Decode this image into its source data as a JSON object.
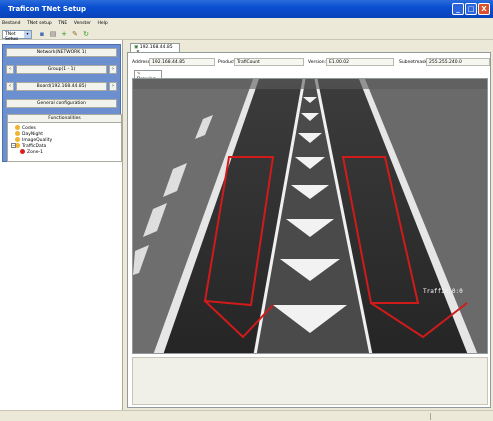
{
  "window": {
    "title": "Traficon TNet Setup",
    "controls": {
      "minimize": "_",
      "maximize": "□",
      "close": "X"
    }
  },
  "menu": [
    "Bestand",
    "TNet setup",
    "TNE",
    "Venster",
    "Help"
  ],
  "toolbar": {
    "selector_value": "TNet Setup",
    "icons": [
      "save-icon",
      "print-icon",
      "add-icon",
      "tools-icon",
      "refresh-icon"
    ]
  },
  "left_panel": {
    "network_label": "Network(NETWORK 1)",
    "group_label": "Group(1 - 1)",
    "board_label": "Board(192.168.44.85)",
    "general_config_label": "General configuration",
    "functionalities": {
      "header": "Functionalities",
      "items": [
        {
          "label": "Codes",
          "icon": "yellow-dot"
        },
        {
          "label": "DayNight",
          "icon": "yellow-dot"
        },
        {
          "label": "ImageQuality",
          "icon": "yellow-dot"
        },
        {
          "label": "TrafficData",
          "icon": "yellow-dot",
          "expanded": true
        },
        {
          "label": "Zone-1",
          "icon": "red-dot"
        }
      ]
    }
  },
  "document": {
    "tab_label": "192.168.44.85",
    "address_label": "Address:",
    "address_value": "192.168.44.85",
    "product_label": "Product:",
    "product_value": "TrafiCount",
    "version_label": "Version:",
    "version_value": "E1.00.02",
    "subnetmask_label": "Subnetmask:",
    "subnetmask_value": "255.255.240.0",
    "drawing_tab_label": "Drawing",
    "overlay_text": "Traffic 0:0"
  },
  "colors": {
    "titlebar": "#0a4fd1",
    "panel_blue": "#6b8fcf",
    "zone_outline": "#d11a1a",
    "road": "#2e2e2e",
    "chrome": "#ece9d8"
  }
}
